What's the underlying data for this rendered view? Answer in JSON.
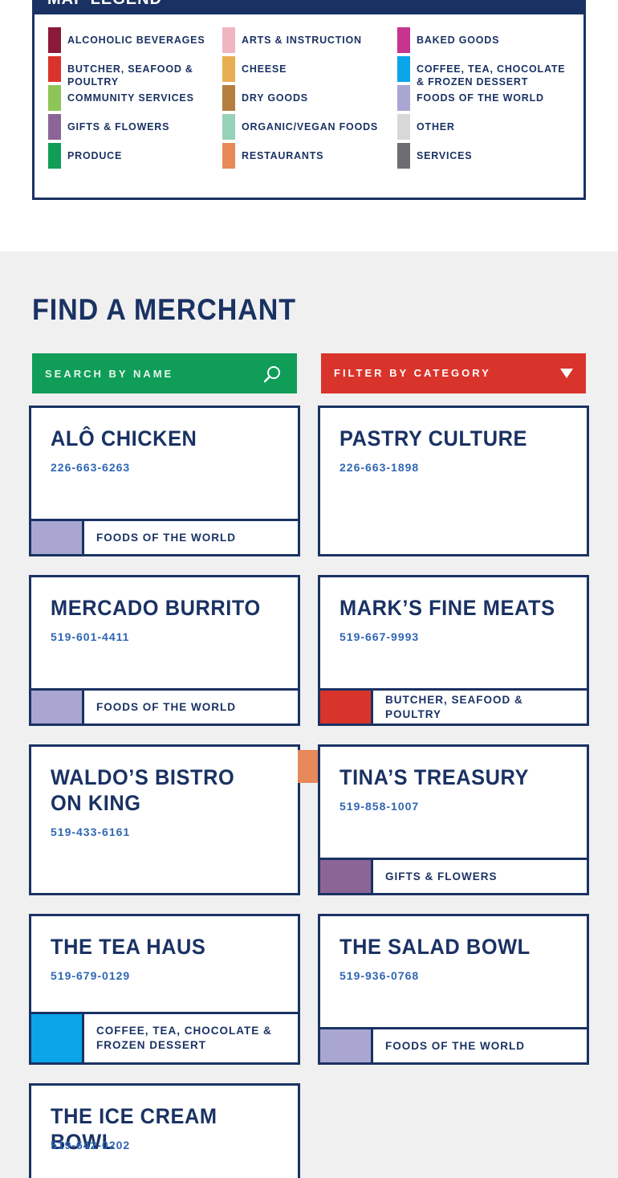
{
  "legend": {
    "title": "Map Legend",
    "items": [
      {
        "label": "Alcoholic Beverages",
        "color": "#8b1a3a"
      },
      {
        "label": "Arts & Instruction",
        "color": "#f0b6c0"
      },
      {
        "label": "Baked Goods",
        "color": "#c7348f"
      },
      {
        "label": "Butcher, Seafood & Poultry",
        "color": "#d9342b"
      },
      {
        "label": "Cheese",
        "color": "#e9ae52"
      },
      {
        "label": "Coffee, Tea, Chocolate & Frozen Dessert",
        "color": "#0aa5e8"
      },
      {
        "label": "Community Services",
        "color": "#8dc559"
      },
      {
        "label": "Dry Goods",
        "color": "#b57d3f"
      },
      {
        "label": "Foods of the World",
        "color": "#a9a6d2"
      },
      {
        "label": "Gifts & Flowers",
        "color": "#8c6597"
      },
      {
        "label": "Organic/Vegan Foods",
        "color": "#96d1b8"
      },
      {
        "label": "Other",
        "color": "#d8d8d8"
      },
      {
        "label": "Produce",
        "color": "#0f9d58"
      },
      {
        "label": "Restaurants",
        "color": "#e8895a"
      },
      {
        "label": "Services",
        "color": "#6d6e71"
      }
    ]
  },
  "finder": {
    "title": "Find a Merchant",
    "search": {
      "placeholder": "Search by Name",
      "value": "",
      "icon": "search-icon"
    },
    "filter": {
      "label": "Filter by Category",
      "icon": "caret-down-icon"
    }
  },
  "merchants": [
    {
      "name": "Alô Chicken",
      "phone": "226-663-6263",
      "category": "Foods of the World",
      "color": "#a9a6d2"
    },
    {
      "name": "Pastry Culture",
      "phone": "226-663-1898",
      "category": "",
      "color": ""
    },
    {
      "name": "Mercado Burrito",
      "phone": "519-601-4411",
      "category": "Foods of the World",
      "color": "#a9a6d2"
    },
    {
      "name": "Mark’s Fine Meats",
      "phone": "519-667-9993",
      "category": "Butcher, Seafood & Poultry",
      "color": "#d9342b"
    },
    {
      "name": "Waldo’s Bistro On King",
      "phone": "519-433-6161",
      "category": "",
      "color": ""
    },
    {
      "name": "Tina’s Treasury",
      "phone": "519-858-1007",
      "category": "Gifts & Flowers",
      "color": "#8c6597"
    },
    {
      "name": "The Tea Haus",
      "phone": "519-679-0129",
      "category": "Coffee, Tea, Chocolate & Frozen Dessert",
      "color": "#0aa5e8"
    },
    {
      "name": "The Salad Bowl",
      "phone": "519-936-0768",
      "category": "Foods of the World",
      "color": "#a9a6d2"
    },
    {
      "name": "The Ice Cream Bowl",
      "phone": "519-642-0202",
      "category": "",
      "color": ""
    }
  ],
  "colors": {
    "navy": "#1a3263",
    "search_bg": "#0f9d58",
    "filter_bg": "#d9342b",
    "phone": "#2f66b3",
    "restaurants_marker": "#e8895a"
  }
}
